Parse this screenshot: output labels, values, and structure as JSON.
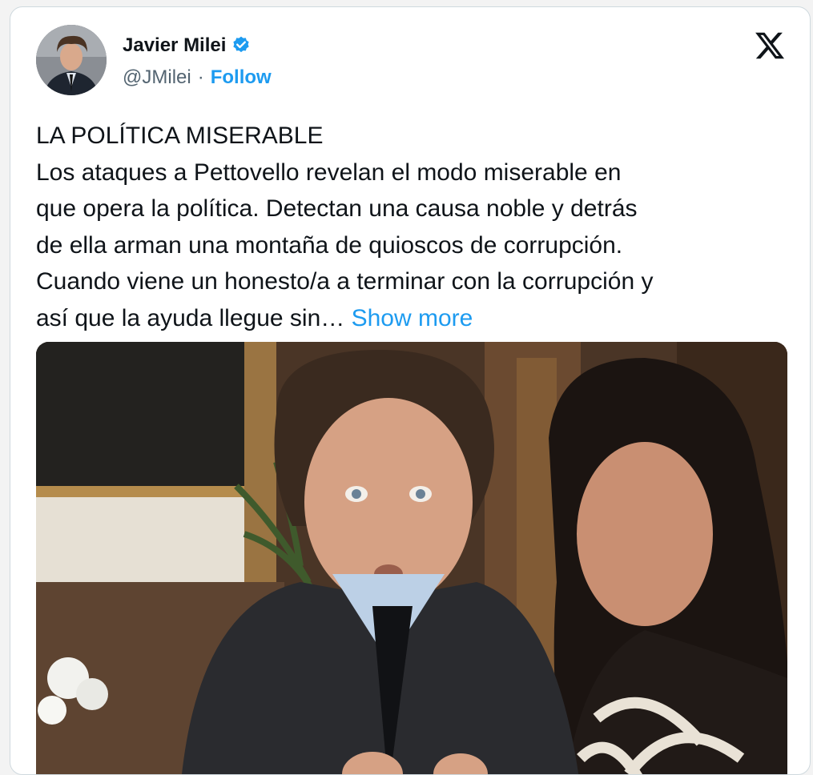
{
  "author": {
    "name": "Javier Milei",
    "handle": "@JMilei",
    "separator": "·",
    "follow_label": "Follow",
    "verified": true
  },
  "brand": {
    "logo": "x-logo-icon"
  },
  "tweet": {
    "lines": [
      "LA POLÍTICA MISERABLE",
      "Los ataques a Pettovello revelan el modo miserable en",
      "que opera la política. Detectan una causa noble y detrás",
      "de ella arman una montaña de quioscos de corrupción.",
      "Cuando viene un honesto/a a terminar con la corrupción y",
      "así que la ayuda llegue sin…"
    ],
    "show_more_label": "Show more"
  },
  "colors": {
    "link": "#1d9bf0",
    "text": "#0f1419",
    "muted": "#536471",
    "border": "#cfd9de"
  }
}
